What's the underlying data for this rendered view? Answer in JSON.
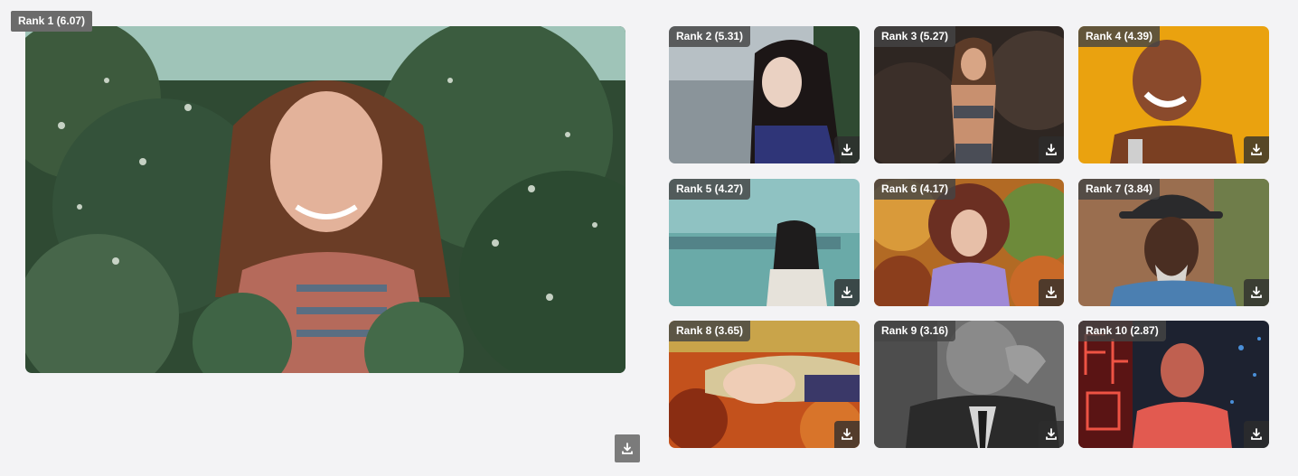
{
  "results": [
    {
      "rank_label": "Rank 1 (6.07)",
      "icon": "download-icon"
    },
    {
      "rank_label": "Rank 2 (5.31)",
      "icon": "download-icon"
    },
    {
      "rank_label": "Rank 3 (5.27)",
      "icon": "download-icon"
    },
    {
      "rank_label": "Rank 4 (4.39)",
      "icon": "download-icon"
    },
    {
      "rank_label": "Rank 5 (4.27)",
      "icon": "download-icon"
    },
    {
      "rank_label": "Rank 6 (4.17)",
      "icon": "download-icon"
    },
    {
      "rank_label": "Rank 7 (3.84)",
      "icon": "download-icon"
    },
    {
      "rank_label": "Rank 8 (3.65)",
      "icon": "download-icon"
    },
    {
      "rank_label": "Rank 9 (3.16)",
      "icon": "download-icon"
    },
    {
      "rank_label": "Rank 10 (2.87)",
      "icon": "download-icon"
    }
  ],
  "colors": {
    "page_background": "#f3f3f5",
    "badge_background": "#444444",
    "badge_text": "#ffffff"
  }
}
